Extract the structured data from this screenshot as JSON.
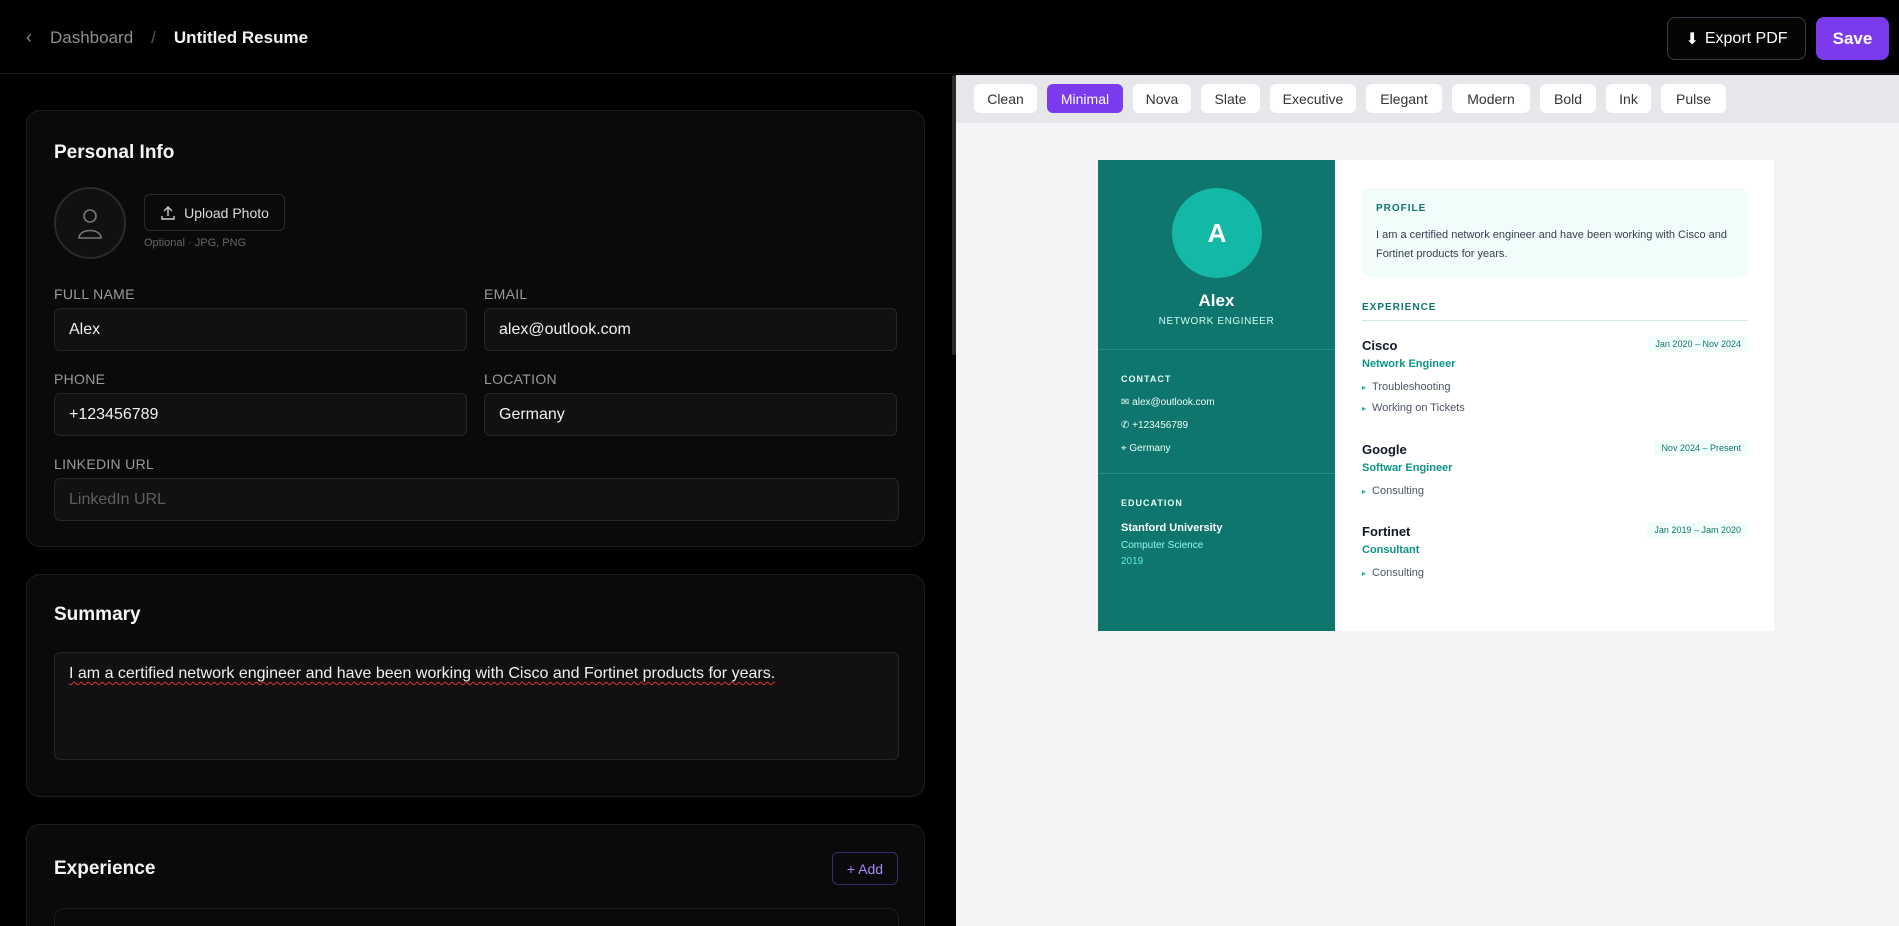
{
  "header": {
    "back_label": "Dashboard",
    "separator": "/",
    "doc_title": "Untitled Resume",
    "export_label": "Export PDF",
    "save_label": "Save"
  },
  "personal": {
    "heading": "Personal Info",
    "upload_label": "Upload Photo",
    "upload_note": "Optional · JPG, PNG",
    "full_name_label": "FULL NAME",
    "full_name": "Alex",
    "email_label": "EMAIL",
    "email": "alex@outlook.com",
    "phone_label": "PHONE",
    "phone": "+123456789",
    "location_label": "LOCATION",
    "location": "Germany",
    "linkedin_label": "LINKEDIN URL",
    "linkedin_placeholder": "LinkedIn URL"
  },
  "summary": {
    "heading": "Summary",
    "text": "I am a certified network engineer and have been working with Cisco and Fortinet products for years."
  },
  "experience": {
    "heading": "Experience",
    "add_label": "+ Add"
  },
  "templates": {
    "items": [
      "Clean",
      "Minimal",
      "Nova",
      "Slate",
      "Executive",
      "Elegant",
      "Modern",
      "Bold",
      "Ink",
      "Pulse"
    ],
    "active": "Minimal",
    "accent": "#7c3aed"
  },
  "preview": {
    "initial": "A",
    "name": "Alex",
    "title": "NETWORK ENGINEER",
    "contact_heading": "CONTACT",
    "contact": [
      "✉ alex@outlook.com",
      "✆ +123456789",
      "⌖ Germany"
    ],
    "education_heading": "EDUCATION",
    "school": "Stanford University",
    "degree": "Computer Science",
    "year": "2019",
    "profile_heading": "PROFILE",
    "profile_text": "I am a certified network engineer and have been working with Cisco and Fortinet products for years.",
    "experience_heading": "EXPERIENCE",
    "jobs": [
      {
        "company": "Cisco",
        "dates": "Jan 2020 – Nov 2024",
        "role": "Network Engineer",
        "bullets": [
          "Troubleshooting",
          "Working on Tickets"
        ]
      },
      {
        "company": "Google",
        "dates": "Nov 2024 – Present",
        "role": "Softwar Engineer",
        "bullets": [
          "Consulting"
        ]
      },
      {
        "company": "Fortinet",
        "dates": "Jan 2019 – Jam 2020",
        "role": "Consultant",
        "bullets": [
          "Consulting"
        ]
      }
    ],
    "side_color": "#0f766e"
  }
}
